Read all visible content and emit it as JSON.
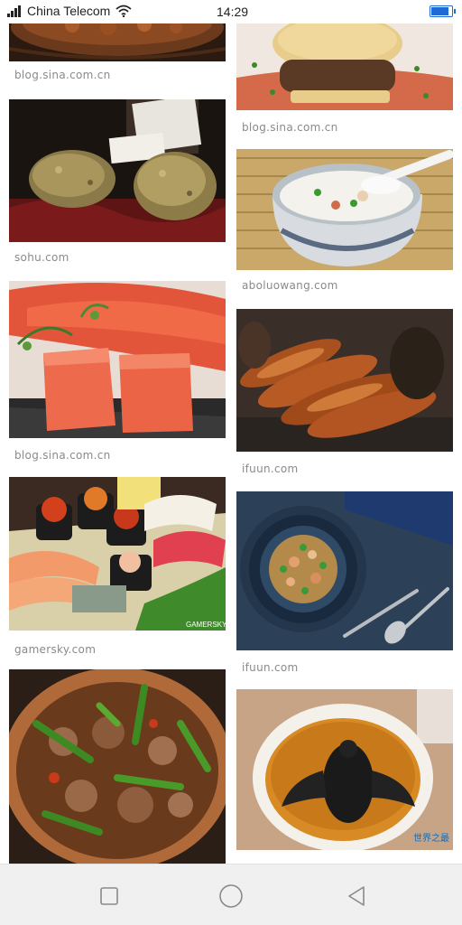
{
  "status_bar": {
    "carrier": "China Telecom",
    "signal_icon": "signal-icon",
    "wifi_icon": "wifi-icon",
    "time": "14:29",
    "battery_icon": "battery-icon",
    "battery_level": 0.9
  },
  "results": {
    "left": [
      {
        "source": "blog.sina.com.cn",
        "image": "braised-dish-in-clay-pot"
      },
      {
        "source": "sohu.com",
        "image": "white-truffles"
      },
      {
        "source": "blog.sina.com.cn",
        "image": "cod-roe"
      },
      {
        "source": "gamersky.com",
        "image": "sushi-platter",
        "watermark": "GAMERSKY"
      },
      {
        "source": "",
        "image": "stir-fried-peppers-meat"
      }
    ],
    "right": [
      {
        "source": "blog.sina.com.cn",
        "image": "burger-with-sauce"
      },
      {
        "source": "aboluowang.com",
        "image": "congee-bowl"
      },
      {
        "source": "ifuun.com",
        "image": "roasted-rodents"
      },
      {
        "source": "ifuun.com",
        "image": "soup-bowl-with-cutlery"
      },
      {
        "source": "",
        "image": "bat-soup",
        "watermark": "世界之最"
      }
    ]
  },
  "nav_bar": {
    "recent_icon": "square-recent-apps-icon",
    "home_icon": "circle-home-icon",
    "back_icon": "triangle-back-icon"
  }
}
